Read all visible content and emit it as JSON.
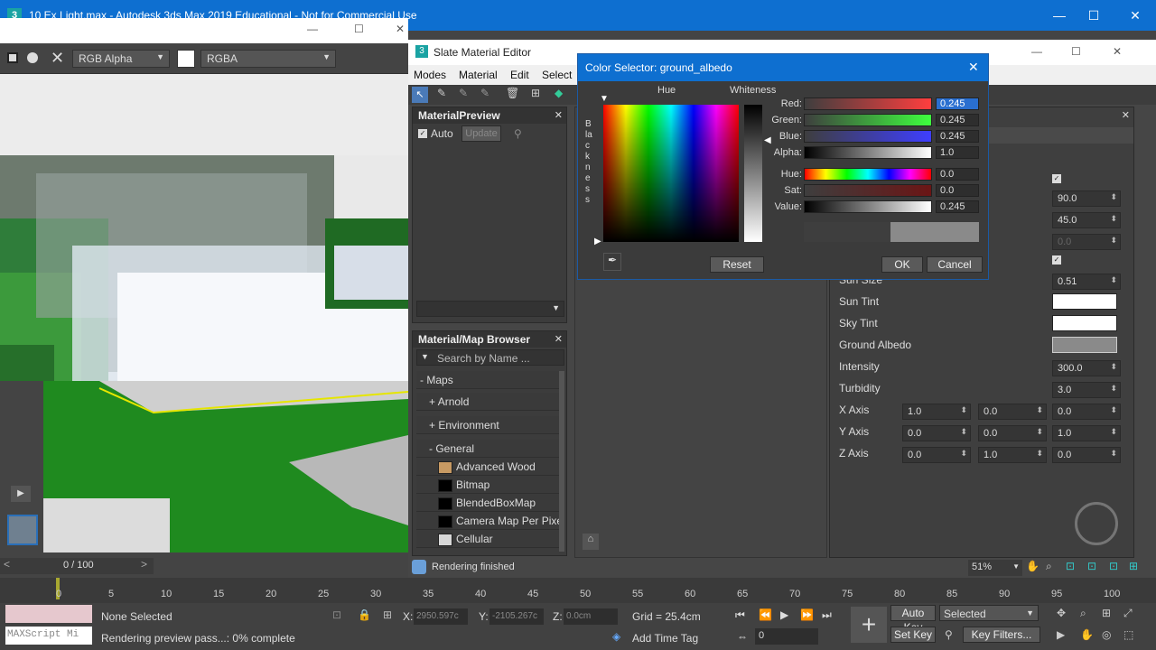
{
  "main_window": {
    "title": "10 Ex Light.max - Autodesk 3ds Max 2019 Educational - Not for Commercial Use",
    "icon": "3"
  },
  "frame_buffer": {
    "channel_select": "RGB Alpha",
    "color_mode": "RGBA"
  },
  "slate": {
    "title": "Slate Material Editor",
    "menu": [
      "Modes",
      "Material",
      "Edit",
      "Select"
    ],
    "material_preview": {
      "title": "MaterialPreview",
      "auto_label": "Auto",
      "update_label": "Update"
    },
    "browser": {
      "title": "Material/Map Browser",
      "search_placeholder": "Search by Name ...",
      "maps_label": "Maps",
      "groups": [
        "Arnold",
        "Environment",
        "General"
      ],
      "items": [
        {
          "name": "Advanced Wood",
          "color": "#c79a63"
        },
        {
          "name": "Bitmap",
          "color": "#000000"
        },
        {
          "name": "BlendedBoxMap",
          "color": "#000000"
        },
        {
          "name": "Camera Map Per Pixel",
          "color": "#000000"
        },
        {
          "name": "Cellular",
          "color": "#d8d8d8"
        }
      ]
    },
    "status": "Rendering finished",
    "zoom": "51%"
  },
  "color_selector": {
    "title": "Color Selector: ground_albedo",
    "hue_label": "Hue",
    "whiteness_label": "Whiteness",
    "blackness_label": "Blackness",
    "rows": [
      {
        "label": "Red:",
        "value": "0.245"
      },
      {
        "label": "Green:",
        "value": "0.245"
      },
      {
        "label": "Blue:",
        "value": "0.245"
      },
      {
        "label": "Alpha:",
        "value": "1.0"
      },
      {
        "label": "Hue:",
        "value": "0.0"
      },
      {
        "label": "Sat:",
        "value": "0.0"
      },
      {
        "label": "Value:",
        "value": "0.245"
      }
    ],
    "reset_label": "Reset",
    "ok_label": "OK",
    "cancel_label": "Cancel",
    "current_color": "#8a8a8a"
  },
  "params": {
    "top_values": [
      "90.0",
      "45.0",
      "0.0"
    ],
    "sun_size": "0.51",
    "rows": [
      {
        "label": "Sun Tint"
      },
      {
        "label": "Sky Tint"
      },
      {
        "label": "Ground Albedo"
      }
    ],
    "intensity_label": "Intensity",
    "intensity": "300.0",
    "turbidity_label": "Turbidity",
    "turbidity": "3.0",
    "axes": [
      {
        "label": "X Axis",
        "v": [
          "1.0",
          "0.0",
          "0.0"
        ]
      },
      {
        "label": "Y Axis",
        "v": [
          "0.0",
          "0.0",
          "1.0"
        ]
      },
      {
        "label": "Z Axis",
        "v": [
          "0.0",
          "1.0",
          "0.0"
        ]
      }
    ],
    "sun_size_label": "Sun Size"
  },
  "timeline": {
    "frame": "0 / 100",
    "ticks": [
      "0",
      "5",
      "10",
      "15",
      "20",
      "25",
      "30",
      "35",
      "40",
      "45",
      "50",
      "55",
      "60",
      "65",
      "70",
      "75",
      "80",
      "85",
      "90",
      "95",
      "100"
    ]
  },
  "status": {
    "selection": "None Selected",
    "prompt": "Rendering preview pass...: 0% complete",
    "maxscript": "MAXScript Mi",
    "x_label": "X:",
    "x_value": "2950.597c",
    "y_label": "Y:",
    "y_value": "-2105.267c",
    "z_label": "Z:",
    "z_value": "0.0cm",
    "grid": "Grid = 25.4cm",
    "add_time_tag": "Add Time Tag",
    "auto_key": "Auto Key",
    "set_key": "Set Key",
    "selected": "Selected",
    "key_filters": "Key Filters...",
    "frame_field": "0"
  }
}
